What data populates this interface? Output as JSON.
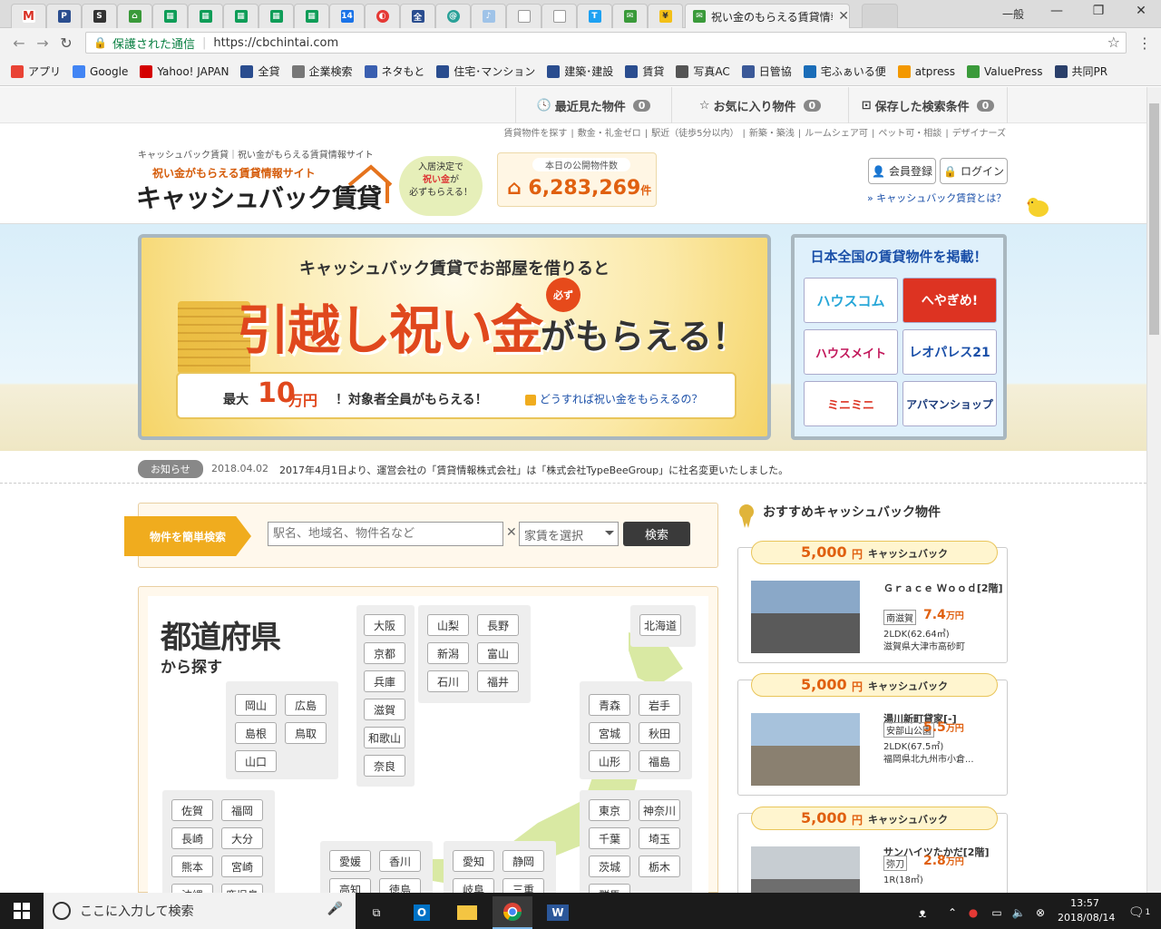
{
  "browser": {
    "active_tab_title": "祝い金のもらえる賃貸情報サ",
    "url_secure": "保護された通信",
    "url": "https://cbchintai.com",
    "window_user": "一般"
  },
  "bookmarks": [
    {
      "label": "アプリ",
      "icon": "apps-grid-icon",
      "color": "#e94335"
    },
    {
      "label": "Google",
      "icon": "google-icon",
      "color": "#4285f4"
    },
    {
      "label": "Yahoo! JAPAN",
      "icon": "yahoo-icon",
      "color": "#d40000"
    },
    {
      "label": "全貸",
      "icon": "zentai-icon",
      "color": "#2a4d8f"
    },
    {
      "label": "企業検索",
      "icon": "page-icon",
      "color": "#777777"
    },
    {
      "label": "ネタもと",
      "icon": "netamoto-icon",
      "color": "#3a5fb0"
    },
    {
      "label": "住宅･マンション",
      "icon": "p-icon",
      "color": "#2a4d8f"
    },
    {
      "label": "建築･建設",
      "icon": "p-icon",
      "color": "#2a4d8f"
    },
    {
      "label": "賃貸",
      "icon": "p-icon",
      "color": "#2a4d8f"
    },
    {
      "label": "写真AC",
      "icon": "photoac-icon",
      "color": "#555555"
    },
    {
      "label": "日管協",
      "icon": "facebook-icon",
      "color": "#3b5998"
    },
    {
      "label": "宅ふぁいる便",
      "icon": "takufile-icon",
      "color": "#1a6db8"
    },
    {
      "label": "atpress",
      "icon": "atpress-icon",
      "color": "#f39800"
    },
    {
      "label": "ValuePress",
      "icon": "valuepress-icon",
      "color": "#3a9a3a"
    },
    {
      "label": "共同PR",
      "icon": "kyodopr-icon",
      "color": "#2a3f6a"
    }
  ],
  "topnav": {
    "recent": "最近見た物件",
    "recent_count": "0",
    "favorites": "お気に入り物件",
    "favorites_count": "0",
    "saved": "保存した検索条件",
    "saved_count": "0"
  },
  "sublinks": [
    "賃貸物件を探す",
    "敷金・礼金ゼロ",
    "駅近（徒歩5分以内）",
    "新築・築浅",
    "ルームシェア可",
    "ペット可・相談",
    "デザイナーズ"
  ],
  "header": {
    "tagline": "キャッシュバック賃貸｜祝い金がもらえる賃貸情報サイト",
    "logo_sub": "祝い金がもらえる賃貸情報サイト",
    "logo_main": "キャッシュバック賃貸",
    "bubble_1": "入居決定で",
    "bubble_2": "祝い金",
    "bubble_3": "が",
    "bubble_4": "必ずもらえる！",
    "count_label": "本日の公開物件数",
    "count": "6,283,269",
    "count_unit": "件",
    "register": "会員登録",
    "login": "ログイン",
    "about": "キャッシュバック賃貸とは？"
  },
  "banner": {
    "head": "キャッシュバック賃貸でお部屋を借りると",
    "big": "引越し祝い金",
    "suffix": "がもらえる！",
    "must": "必ず",
    "max_label": "最大",
    "max_num": "10",
    "max_unit": "万円",
    "all": "！対象者全員がもらえる！",
    "howto": "どうすれば祝い金をもらえるの？"
  },
  "partners": {
    "heading": "日本全国の賃貸物件を掲載！",
    "logos": [
      "ハウスコム",
      "へやぎめ!",
      "ハウスメイト",
      "レオパレス21",
      "ミニミニ",
      "アパマンショップ"
    ]
  },
  "news": {
    "tag": "お知らせ",
    "date": "2018.04.02",
    "text": "2017年4月1日より、運営会社の「賃貸情報株式会社」は「株式会社TypeBeeGroup」に社名変更いたしました。"
  },
  "search": {
    "label": "物件を簡単検索",
    "placeholder": "駅名、地域名、物件名など",
    "rent_select": "家賃を選択",
    "button": "検索"
  },
  "prefectures": {
    "title": "都道府県",
    "subtitle": "から探す",
    "hokkaido": [
      "北海道"
    ],
    "tohoku": [
      "青森",
      "岩手",
      "宮城",
      "秋田",
      "山形",
      "福島"
    ],
    "kanto": [
      "東京",
      "神奈川",
      "千葉",
      "埼玉",
      "茨城",
      "栃木",
      "群馬"
    ],
    "koshinetsu": [
      "山梨",
      "長野",
      "新潟",
      "富山",
      "石川",
      "福井"
    ],
    "kansai": [
      "大阪",
      "京都",
      "兵庫",
      "滋賀",
      "和歌山",
      "奈良"
    ],
    "chugoku": [
      "岡山",
      "広島",
      "島根",
      "鳥取",
      "山口"
    ],
    "kyushu": [
      "佐賀",
      "福岡",
      "長崎",
      "大分",
      "熊本",
      "宮崎",
      "沖縄",
      "鹿児島"
    ],
    "shikoku": [
      "愛媛",
      "香川",
      "高知",
      "徳島"
    ],
    "tokai": [
      "愛知",
      "静岡",
      "岐阜",
      "三重"
    ]
  },
  "recommend": {
    "title": "おすすめキャッシュバック物件",
    "yen": "円",
    "cashback": "キャッシュバック",
    "items": [
      {
        "amount": "5,000",
        "name": "Ｇｒａｃｅ Ｗｏｏｄ[2階]",
        "station": "南滋賀",
        "price": "7.4",
        "unit": "万円",
        "layout": "2LDK(62.64㎡)",
        "location": "滋賀県大津市高砂町"
      },
      {
        "amount": "5,000",
        "name": "湯川新町貸家[-]",
        "station": "安部山公園",
        "price": "5.5",
        "unit": "万円",
        "layout": "2LDK(67.5㎡)",
        "location": "福岡県北九州市小倉..."
      },
      {
        "amount": "5,000",
        "name": "サンハイツたかだ[2階]",
        "station": "弥刀",
        "price": "2.8",
        "unit": "万円",
        "layout": "1R(18㎡)",
        "location": ""
      }
    ]
  },
  "taskbar": {
    "search_placeholder": "ここに入力して検索",
    "time": "13:57",
    "date": "2018/08/14",
    "notif_count": "1"
  }
}
